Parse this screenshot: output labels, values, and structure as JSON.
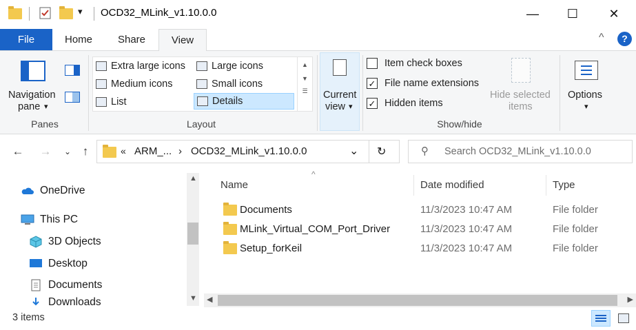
{
  "window": {
    "title": "OCD32_MLink_v1.10.0.0",
    "min_symbol": "—",
    "max_symbol": "☐",
    "close_symbol": "✕",
    "quick_access_dropdown": "▾"
  },
  "ribbon_tabs": [
    "File",
    "Home",
    "Share",
    "View"
  ],
  "ribbon": {
    "collapse_symbol": "^",
    "help_symbol": "?",
    "panes": {
      "nav_pane_label_1": "Navigation",
      "nav_pane_label_2": "pane",
      "nav_pane_caret": "▾",
      "group_label": "Panes"
    },
    "layout": {
      "items": [
        {
          "label": "Extra large icons",
          "selected": false
        },
        {
          "label": "Large icons",
          "selected": false
        },
        {
          "label": "Medium icons",
          "selected": false
        },
        {
          "label": "Small icons",
          "selected": false
        },
        {
          "label": "List",
          "selected": false
        },
        {
          "label": "Details",
          "selected": true
        }
      ],
      "group_label": "Layout"
    },
    "current_view": {
      "label_1": "Current",
      "label_2": "view",
      "caret": "▾"
    },
    "show_hide": {
      "checkboxes": [
        {
          "label": "Item check boxes",
          "checked": false
        },
        {
          "label": "File name extensions",
          "checked": true
        },
        {
          "label": "Hidden items",
          "checked": true
        }
      ],
      "hide_selected_1": "Hide selected",
      "hide_selected_2": "items",
      "group_label": "Show/hide"
    },
    "options": {
      "label": "Options",
      "caret": "▾"
    }
  },
  "address_bar": {
    "chevron_prefix": "«",
    "crumb_1": "ARM_...",
    "separator": "›",
    "crumb_2": "OCD32_MLink_v1.10.0.0",
    "dropdown": "⌄",
    "refresh": "↻"
  },
  "search": {
    "placeholder": "Search OCD32_MLink_v1.10.0.0"
  },
  "nav_pane": {
    "items": [
      {
        "label": "OneDrive",
        "icon": "cloud-icon"
      },
      {
        "label": "This PC",
        "icon": "computer-icon"
      },
      {
        "label": "3D Objects",
        "icon": "cube-icon"
      },
      {
        "label": "Desktop",
        "icon": "desktop-icon"
      },
      {
        "label": "Documents",
        "icon": "document-icon"
      },
      {
        "label": "Downloads",
        "icon": "download-icon"
      }
    ]
  },
  "file_list": {
    "columns": [
      "Name",
      "Date modified",
      "Type"
    ],
    "sort_indicator": "^",
    "rows": [
      {
        "name": "Documents",
        "date": "11/3/2023 10:47 AM",
        "type": "File folder"
      },
      {
        "name": "MLink_Virtual_COM_Port_Driver",
        "date": "11/3/2023 10:47 AM",
        "type": "File folder"
      },
      {
        "name": "Setup_forKeil",
        "date": "11/3/2023 10:47 AM",
        "type": "File folder"
      }
    ]
  },
  "status_bar": {
    "item_count": "3 items"
  },
  "colors": {
    "file_tab": "#1a63c7",
    "folder": "#f3c94f",
    "selection": "#cce8ff"
  }
}
